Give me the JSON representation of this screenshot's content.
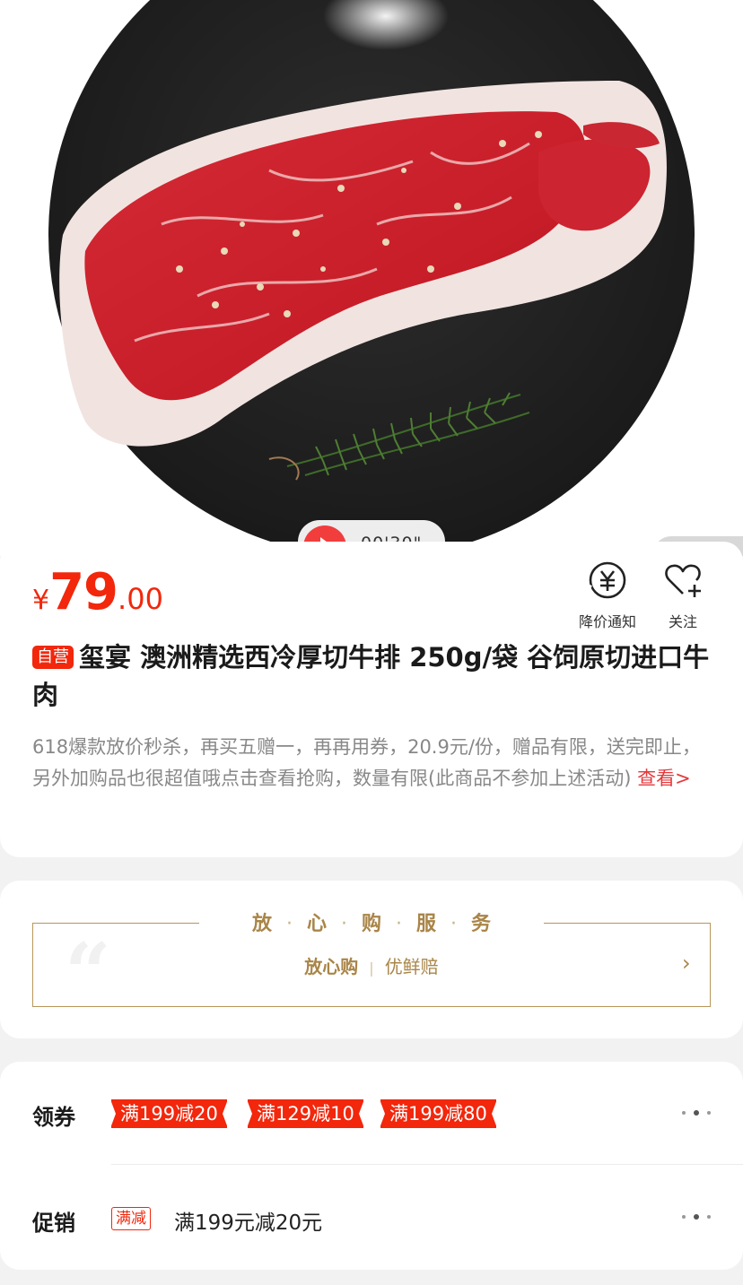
{
  "video": {
    "duration": "00'30\""
  },
  "price": {
    "currency": "¥",
    "integer": "79",
    "decimal": ".00"
  },
  "actions": {
    "notify": {
      "label": "降价通知",
      "icon": "price-alert-icon"
    },
    "follow": {
      "label": "关注",
      "icon": "heart-plus-icon"
    }
  },
  "product": {
    "tag": "自营",
    "title": "玺宴 澳洲精选西冷厚切牛排 250g/袋 谷饲原切进口牛肉",
    "description": "618爆款放价秒杀，再买五赠一，再再用券，20.9元/份，赠品有限，送完即止，另外加购品也很超值哦点击查看抢购，数量有限(此商品不参加上述活动)",
    "more_link": "查看>"
  },
  "service": {
    "title_chars": [
      "放",
      "心",
      "购",
      "服",
      "务"
    ],
    "items": [
      "放心购",
      "优鲜赔"
    ],
    "arrow": "›",
    "accent": "#a98548"
  },
  "coupons": {
    "label": "领券",
    "items": [
      "满199减20",
      "满129减10",
      "满199减80"
    ]
  },
  "promotion": {
    "label": "促销",
    "tag": "满减",
    "text": "满199元减20元"
  },
  "colors": {
    "brand_red": "#f2270c",
    "gold": "#a98548"
  }
}
